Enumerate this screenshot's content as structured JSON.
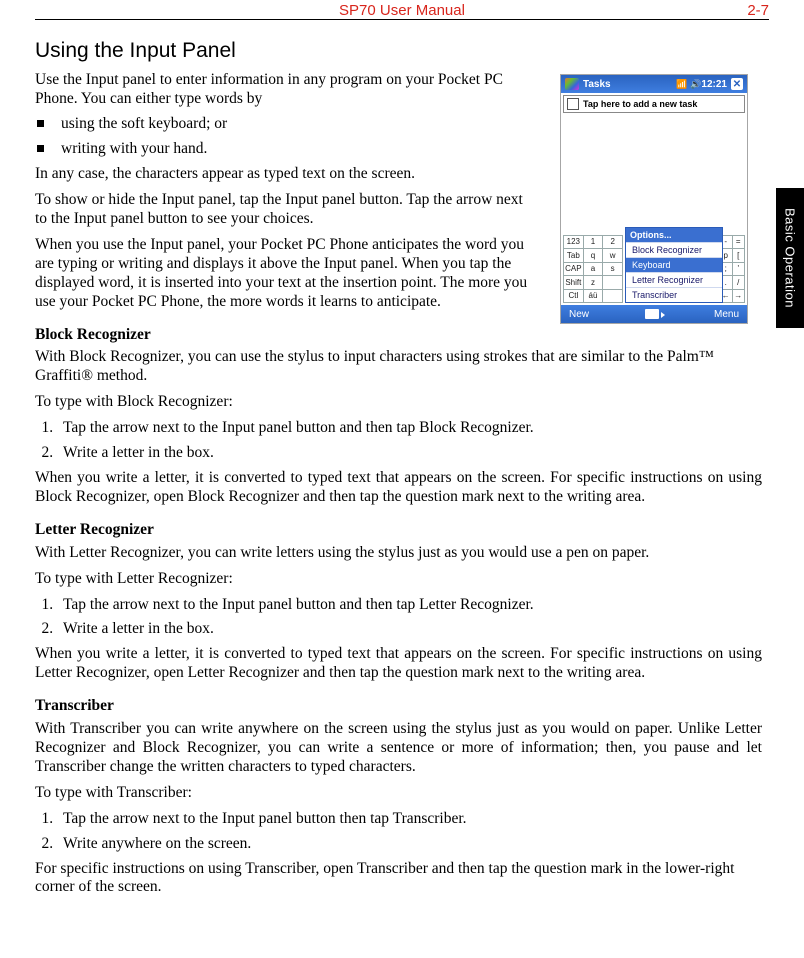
{
  "header": {
    "title": "SP70 User Manual",
    "page": "2-7"
  },
  "sidetab": "Basic Operation",
  "sectionTitle": "Using the Input Panel",
  "intro1": "Use the Input panel to enter information in any program on your Pocket PC Phone. You can either type  words by",
  "bullets": [
    "using the soft keyboard; or",
    "writing with your hand."
  ],
  "intro2": "In any case, the characters appear as typed text on the screen.",
  "intro3": "To show or hide the Input panel, tap the Input panel button. Tap the arrow next to the Input panel button to see your choices.",
  "intro4": "When you use the Input panel, your Pocket PC Phone anticipates the word you are typing or writing and displays it above the Input panel. When you tap the displayed word, it is inserted into your text at the insertion point. The more you use your Pocket PC Phone, the more words it learns to anticipate.",
  "br": {
    "title": "Block Recognizer",
    "p1": "With Block Recognizer, you can use the stylus to input characters using strokes that are similar to the Palm™ Graffiti® method.",
    "p2": "To type with Block Recognizer:",
    "steps": [
      "Tap the arrow next to the Input panel button and then tap Block Recognizer.",
      "Write a letter in the box."
    ],
    "p3": "When you write a letter, it is converted to typed text that appears on the screen. For specific instructions on using Block Recognizer, open Block Recognizer and then tap the question mark next to the writing area."
  },
  "lr": {
    "title": "Letter Recognizer",
    "p1": "With Letter Recognizer, you can write letters using the stylus just as you would use a pen on paper.",
    "p2": "To type with Letter Recognizer:",
    "steps": [
      "Tap the arrow next to the Input panel button and then tap Letter Recognizer.",
      "Write a letter in the box."
    ],
    "p3": "When you write a letter, it is converted to typed text that appears on the screen. For specific instructions on using Letter Recognizer, open Letter Recognizer and then tap the question mark next to the writing area."
  },
  "tr": {
    "title": "Transcriber",
    "p1": "With Transcriber you can write anywhere on the screen using the stylus just as you would on paper. Unlike Letter Recognizer and Block Recognizer, you can write a sentence or more of information; then, you pause and let Transcriber change the written characters to typed characters.",
    "p2": "To type with Transcriber:",
    "steps": [
      "Tap the arrow next to the Input panel button then tap Transcriber.",
      "Write anywhere on the screen."
    ],
    "p3": "For specific instructions on using Transcriber, open Transcriber and then tap the question mark in the lower-right corner of the screen."
  },
  "device": {
    "title": "Tasks",
    "time": "12:21",
    "hint": "Tap here to add a new task",
    "optionsLabel": "Options...",
    "menu": [
      "Block Recognizer",
      "Keyboard",
      "Letter Recognizer",
      "Transcriber"
    ],
    "selectedIndex": 1,
    "newLabel": "New",
    "menuLabel": "Menu",
    "kbLeft": [
      [
        "123",
        "1",
        "2"
      ],
      [
        "Tab",
        "q",
        "w"
      ],
      [
        "CAP",
        "a",
        "s"
      ],
      [
        "Shift",
        "z",
        ""
      ],
      [
        "Ctl",
        "áü",
        ""
      ]
    ],
    "kbRight": [
      [
        "-",
        "="
      ],
      [
        "p",
        "[",
        "]"
      ],
      [
        ";",
        "'"
      ],
      [
        ".",
        "/"
      ],
      [
        "←",
        "→"
      ]
    ]
  }
}
